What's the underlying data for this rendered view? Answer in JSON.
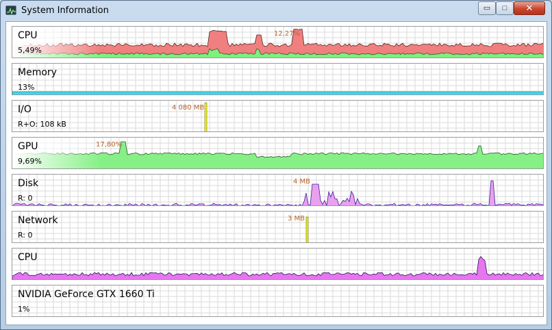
{
  "window": {
    "title": "System Information",
    "minimize_glyph": "▭",
    "maximize_glyph": "□",
    "close_glyph": "✕"
  },
  "app_icon": "activity-graph-icon",
  "panels": [
    {
      "id": "cpu",
      "name": "CPU",
      "value": "5,49%",
      "peak_label": "12,27%",
      "fill": "#f07f7f",
      "stroke": "#5a2222",
      "fill2": "#7ef07e",
      "fade": true
    },
    {
      "id": "memory",
      "name": "Memory",
      "value": "13%",
      "peak_label": "",
      "fill": "#3ed8f2",
      "stroke": "#1b6f84"
    },
    {
      "id": "io",
      "name": "I/O",
      "value": "R+O: 108 kB",
      "peak_label": "4 080 MB",
      "fill": "#f4f41c",
      "stroke": "#6f6f00"
    },
    {
      "id": "gpu",
      "name": "GPU",
      "value": "9,69%",
      "peak_label": "17,80%",
      "fill": "#86f086",
      "stroke": "#2d5a2d",
      "fade": true
    },
    {
      "id": "disk",
      "name": "Disk",
      "value": "R: 0",
      "peak_label": "4 MB",
      "fill": "#e9a0ee",
      "stroke": "#3a1d9a"
    },
    {
      "id": "network",
      "name": "Network",
      "value": "R: 0",
      "peak_label": "3 MB",
      "fill": "#eded2a",
      "stroke": "#6f6f00"
    },
    {
      "id": "cpu2",
      "name": "CPU",
      "value": "",
      "peak_label": "",
      "fill": "#e676ee",
      "stroke": "#2a0f5e"
    },
    {
      "id": "gpu-model",
      "name": "NVIDIA GeForce GTX 1660 Ti",
      "value": "1%",
      "peak_label": "",
      "fill": "#3fb23f",
      "stroke": "#2a7a2a"
    }
  ]
}
